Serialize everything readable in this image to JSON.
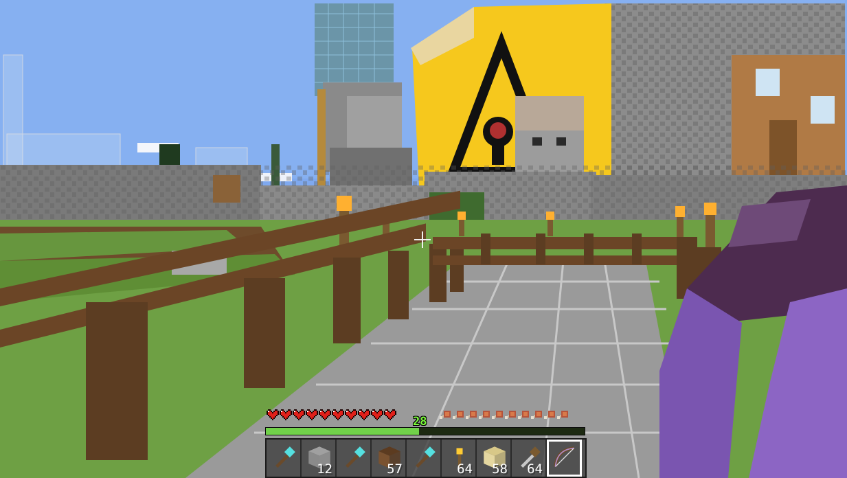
{
  "game": {
    "title": "Minecraft"
  },
  "hud": {
    "health": {
      "hearts_filled": 10,
      "hearts_total": 10
    },
    "hunger": {
      "drumsticks_filled": 10,
      "drumsticks_total": 10
    },
    "experience": {
      "level": "28",
      "progress_fraction": 0.48
    },
    "hotbar": {
      "selected_index": 8,
      "slots": [
        {
          "item": "diamond-shovel",
          "count": ""
        },
        {
          "item": "stone-block",
          "count": "12"
        },
        {
          "item": "diamond-pickaxe",
          "count": ""
        },
        {
          "item": "dirt-block",
          "count": "57"
        },
        {
          "item": "diamond-axe",
          "count": ""
        },
        {
          "item": "torch",
          "count": "64"
        },
        {
          "item": "sand-block",
          "count": "58"
        },
        {
          "item": "arrow",
          "count": "64"
        },
        {
          "item": "enchanted-bow",
          "count": ""
        }
      ]
    }
  },
  "colors": {
    "sky": "#7fa9ef",
    "heart": "#e0201a",
    "xp": "#71d14a",
    "sign_yellow": "#f6c81d"
  }
}
